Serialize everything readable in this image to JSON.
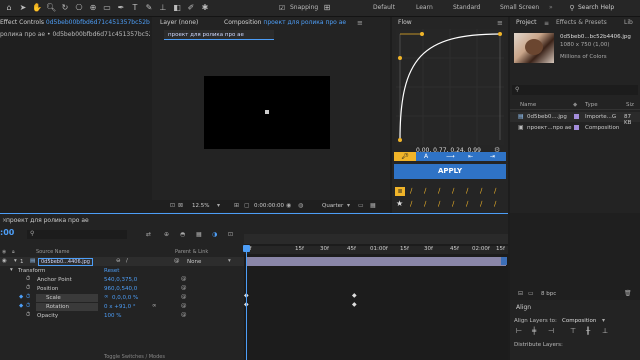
{
  "toolbar": {
    "snapping_label": "Snapping",
    "workspaces": [
      "Default",
      "Learn",
      "Standard",
      "Small Screen"
    ],
    "search_placeholder": "Search Help"
  },
  "effect_controls": {
    "tab_label": "Effect Controls",
    "tab_file": "0d5beb00bfbd6d71c451357bc52b440",
    "breadcrumb": "ролика про ae • 0d5beb00bfbd6d71c451357bc52b4406.jpg"
  },
  "layer_panel": {
    "label": "Layer (none)"
  },
  "composition": {
    "tab_label": "Composition",
    "tab_name": "проект для ролика про ae",
    "crumb": "проект для ролика про ae",
    "zoom": "12.5%",
    "timecode": "0:00:00:00",
    "resolution": "Quarter"
  },
  "flow": {
    "title": "Flow",
    "values": "0.00, 0.77, 0.24, 0.99",
    "apply_label": "APPLY"
  },
  "project": {
    "title": "Project",
    "tab2": "Effects & Presets",
    "tab3": "Lib",
    "thumb_name": "0d5beb0...bc52b4406.jpg",
    "thumb_dims": "1080 x 750 (1,00)",
    "thumb_colors": "Millions of Colors",
    "search_icon": "search-icon",
    "col_name": "Name",
    "col_type": "Type",
    "col_size": "Siz",
    "items": [
      {
        "name": "0d5beb0....jpg",
        "type": "Importe...G",
        "size": "87 KB",
        "color": "#b8b8b8"
      },
      {
        "name": "проект...про ae",
        "type": "Composition",
        "size": "",
        "color": "#b8b8b8"
      }
    ],
    "bpc": "8 bpc"
  },
  "timeline": {
    "tab_label": "проект для ролика про ae",
    "timecode": ":00",
    "col_source": "Source Name",
    "col_parent": "Parent & Link",
    "layer_num": "1",
    "layer_name": "0d5beb0...4406.jpg",
    "parent_value": "None",
    "ruler": [
      "0f",
      "15f",
      "30f",
      "45f",
      "01:00f",
      "15f",
      "30f",
      "45f",
      "02:00f",
      "15f"
    ],
    "toggle_label": "Toggle Switches / Modes",
    "transform": {
      "label": "Transform",
      "reset": "Reset"
    },
    "props": [
      {
        "name": "Anchor Point",
        "value": "540,0,375,0"
      },
      {
        "name": "Position",
        "value": "960,0,540,0"
      },
      {
        "name": "Scale",
        "value": "0,0,0,0 %"
      },
      {
        "name": "Rotation",
        "value": "0 x +91,0 °"
      },
      {
        "name": "Opacity",
        "value": "100 %"
      }
    ]
  },
  "align": {
    "title": "Align",
    "align_to_label": "Align Layers to:",
    "align_to_value": "Composition",
    "distribute_label": "Distribute Layers:"
  },
  "colors": {
    "accent_blue": "#4d9ef7",
    "apply_blue": "#2f73c6",
    "curve_orange": "#f0b429",
    "label_purple": "#a48ddb"
  }
}
